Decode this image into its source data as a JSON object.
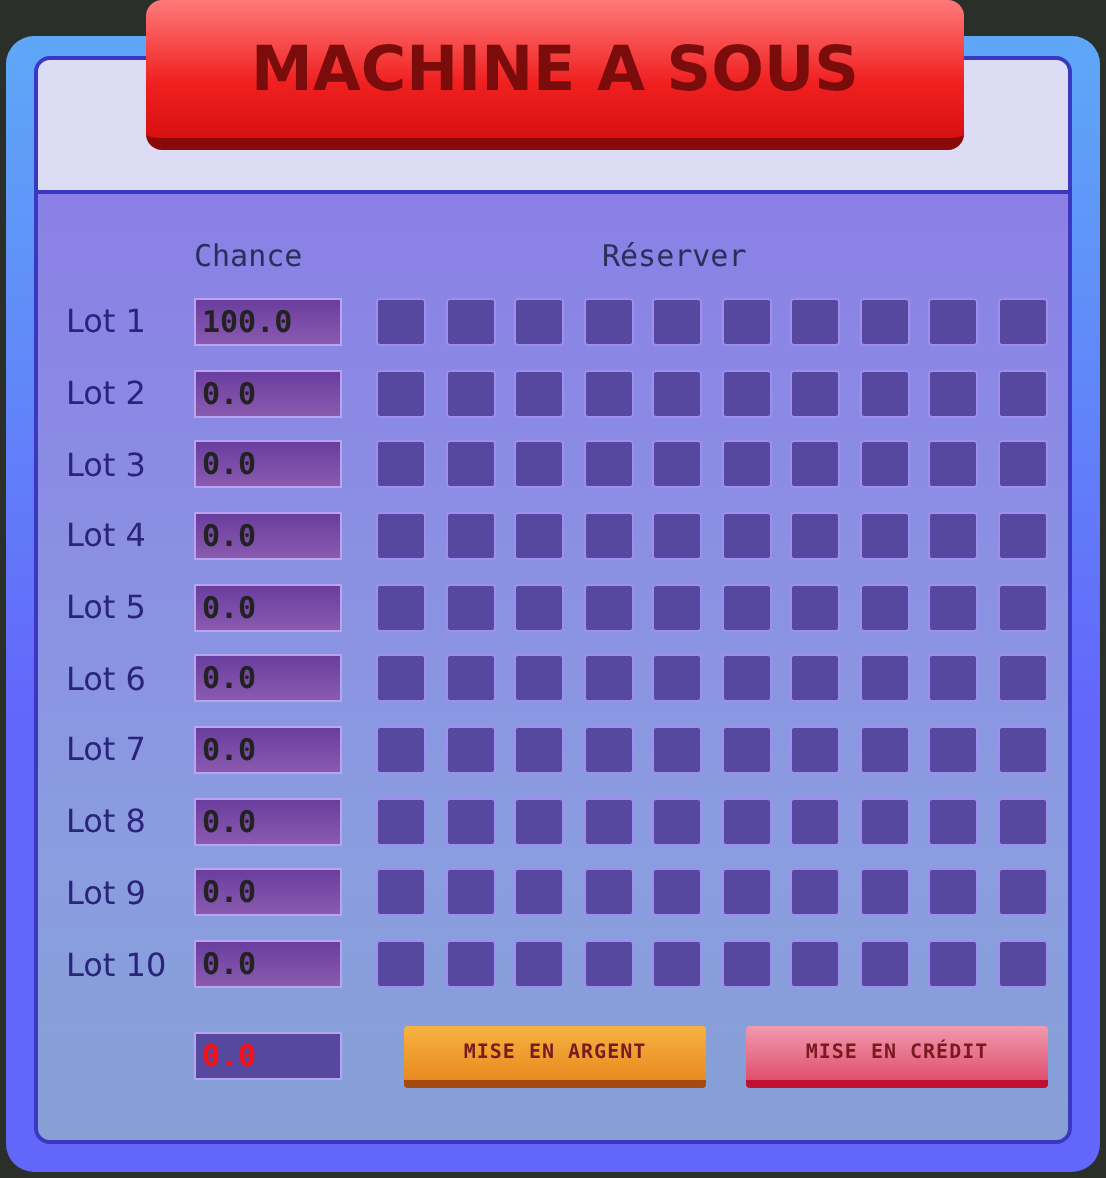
{
  "title": "MACHINE A SOUS",
  "headers": {
    "chance": "Chance",
    "reserve": "Réserver"
  },
  "lots": [
    {
      "label": "Lot 1",
      "chance": "100.0"
    },
    {
      "label": "Lot 2",
      "chance": "0.0"
    },
    {
      "label": "Lot 3",
      "chance": "0.0"
    },
    {
      "label": "Lot 4",
      "chance": "0.0"
    },
    {
      "label": "Lot 5",
      "chance": "0.0"
    },
    {
      "label": "Lot 6",
      "chance": "0.0"
    },
    {
      "label": "Lot 7",
      "chance": "0.0"
    },
    {
      "label": "Lot 8",
      "chance": "0.0"
    },
    {
      "label": "Lot 9",
      "chance": "0.0"
    },
    {
      "label": "Lot 10",
      "chance": "0.0"
    }
  ],
  "bet": {
    "value": "0.0"
  },
  "buttons": [
    {
      "label": "MISE EN ARGENT",
      "kind": "money"
    },
    {
      "label": "MISE EN CRÉDIT",
      "kind": "credit"
    }
  ]
}
